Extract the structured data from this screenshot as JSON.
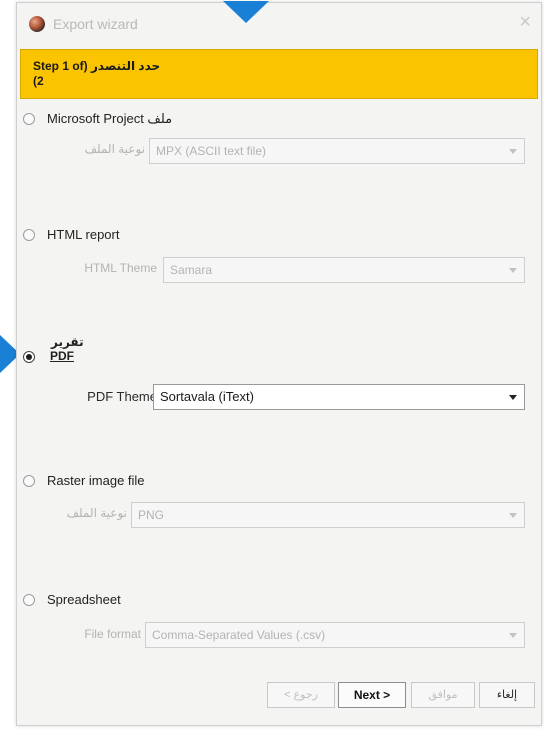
{
  "window": {
    "title": "Export wizard",
    "close_glyph": "×",
    "icon": "app-logo-icon"
  },
  "step_banner": {
    "text": "Step 1 of) حدد التنصدر\n(2",
    "color": "#fac500"
  },
  "options": {
    "microsoft_project": {
      "label": "Microsoft Project ملف",
      "selected": false,
      "field_label": "نوعية الملف",
      "field_value": "MPX (ASCII text file)"
    },
    "html_report": {
      "label": "HTML report",
      "selected": false,
      "field_label": "HTML Theme",
      "field_value": "Samara"
    },
    "pdf": {
      "label_ar": "تقرير",
      "label_en": "PDF",
      "selected": true,
      "field_label": "PDF Theme",
      "field_value": "Sortavala (iText)"
    },
    "raster_image": {
      "label": "Raster image file",
      "selected": false,
      "field_label": "نوعية الملف",
      "field_value": "PNG"
    },
    "spreadsheet": {
      "label": "Spreadsheet",
      "selected": false,
      "field_label": "File format",
      "field_value": "Comma-Separated Values (.csv)"
    }
  },
  "footer": {
    "back_label": "< رجوع",
    "next_label": "Next >",
    "finish_label": "موافق",
    "cancel_label": "إلغاء"
  },
  "colors": {
    "accent_marker": "#1a80d6",
    "banner": "#fac500"
  }
}
